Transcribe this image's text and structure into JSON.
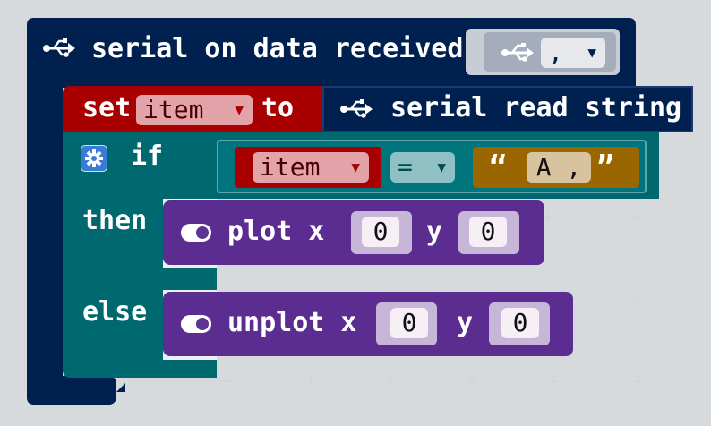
{
  "colors": {
    "workspace": "#ecf0f1",
    "serial": "#002050",
    "variables": "#a80000",
    "logic": "#006970",
    "led": "#5c2d91",
    "text": "#996600",
    "field_bg": "#e2a4a8"
  },
  "event_block": {
    "icon": "usb-icon",
    "label": "serial on data received",
    "delimiter_icon": "usb-icon",
    "delimiter_value": ","
  },
  "set_block": {
    "keyword": "set",
    "variable": "item",
    "to_label": "to",
    "reporter_icon": "usb-icon",
    "reporter_label": "serial read string"
  },
  "if_block": {
    "settings_icon": "gear-icon",
    "if_label": "if",
    "compare_left_variable": "item",
    "operator": "=",
    "string_open_quote": "“",
    "string_value": "A ,",
    "string_close_quote": "”",
    "then_label": "then",
    "else_label": "else"
  },
  "plot_block": {
    "icon": "toggle-icon",
    "label": "plot x",
    "x_value": "0",
    "y_label": "y",
    "y_value": "0"
  },
  "unplot_block": {
    "icon": "toggle-icon",
    "label": "unplot x",
    "x_value": "0",
    "y_label": "y",
    "y_value": "0"
  }
}
